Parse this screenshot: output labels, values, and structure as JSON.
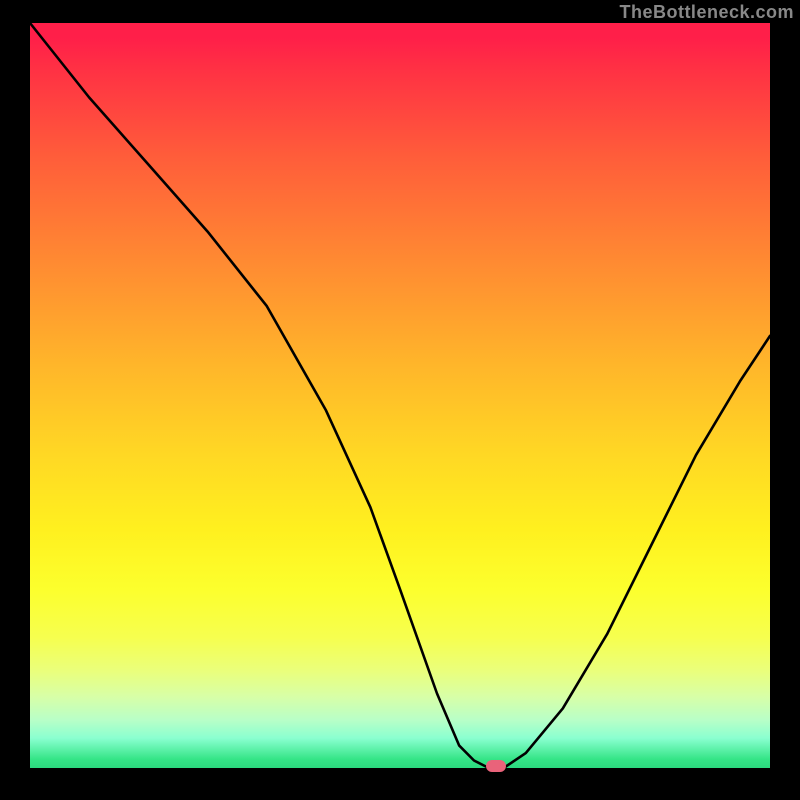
{
  "attribution": "TheBottleneck.com",
  "chart_data": {
    "type": "line",
    "title": "",
    "xlabel": "",
    "ylabel": "",
    "ylim": [
      0,
      100
    ],
    "xlim": [
      0,
      100
    ],
    "x": [
      0,
      8,
      16,
      24,
      32,
      40,
      46,
      50,
      55,
      58,
      60,
      62,
      64,
      67,
      72,
      78,
      84,
      90,
      96,
      100
    ],
    "values": [
      100,
      90,
      81,
      72,
      62,
      48,
      35,
      24,
      10,
      3,
      1,
      0,
      0,
      2,
      8,
      18,
      30,
      42,
      52,
      58
    ],
    "marker": {
      "x": 63,
      "y": 0
    },
    "gradient_stops": [
      {
        "pct": 0,
        "color": "#ff1f49"
      },
      {
        "pct": 50,
        "color": "#ffc225"
      },
      {
        "pct": 80,
        "color": "#fbff30"
      },
      {
        "pct": 100,
        "color": "#2cd97f"
      }
    ]
  }
}
